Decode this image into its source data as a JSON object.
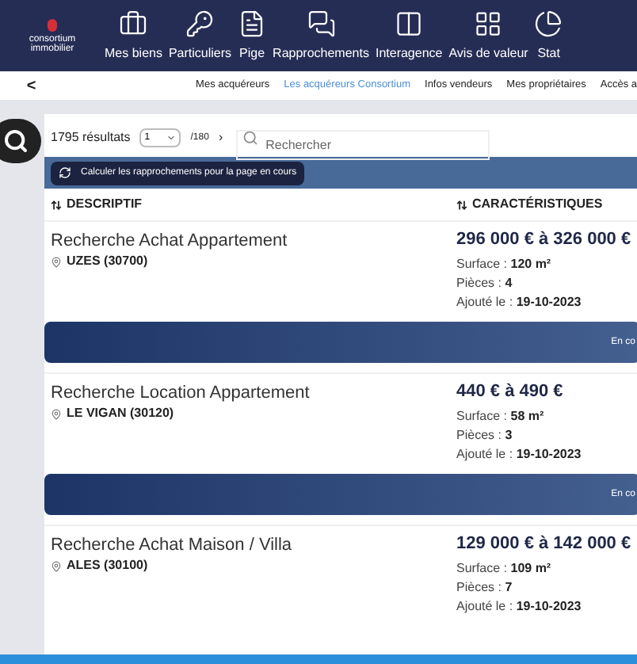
{
  "nav": {
    "items": [
      {
        "label": "Mes biens"
      },
      {
        "label": "Particuliers"
      },
      {
        "label": "Pige"
      },
      {
        "label": "Rapprochements"
      },
      {
        "label": "Interagence"
      },
      {
        "label": "Avis de valeur"
      },
      {
        "label": "Stat"
      }
    ]
  },
  "logo": {
    "line1": "consortium",
    "line2": "immobilier"
  },
  "subnav": {
    "back": "<",
    "tabs": [
      {
        "label": "Mes acquéreurs",
        "selected": false
      },
      {
        "label": "Les acquéreurs Consortium",
        "selected": true
      },
      {
        "label": "Infos vendeurs",
        "selected": false
      },
      {
        "label": "Mes propriétaires",
        "selected": false
      },
      {
        "label": "Accès a",
        "selected": false
      }
    ]
  },
  "toolbar": {
    "count": "1795 résultats",
    "page": "1",
    "total": "/180",
    "next": "›",
    "search_placeholder": "Rechercher"
  },
  "action_button": "Calculer les rapprochements pour la page en cours",
  "table": {
    "columns": [
      "DESCRIPTIF",
      "CARACTÉRISTIQUES"
    ],
    "rows": [
      {
        "title": "Recherche Achat Appartement",
        "location": "UZES (30700)",
        "price": "296 000 € à 326 000 €",
        "fields": [
          {
            "label": "Surface :",
            "value": "120 m²"
          },
          {
            "label": "Pièces :",
            "value": "4"
          },
          {
            "label": "Ajouté le :",
            "value": "19-10-2023"
          }
        ],
        "banner": "En co"
      },
      {
        "title": "Recherche Location Appartement",
        "location": "LE VIGAN (30120)",
        "price": "440 € à 490 €",
        "fields": [
          {
            "label": "Surface :",
            "value": "58 m²"
          },
          {
            "label": "Pièces :",
            "value": "3"
          },
          {
            "label": "Ajouté le :",
            "value": "19-10-2023"
          }
        ],
        "banner": "En co"
      },
      {
        "title": "Recherche Achat Maison / Villa",
        "location": "ALES (30100)",
        "price": "129 000 € à 142 000 €",
        "fields": [
          {
            "label": "Surface :",
            "value": "109 m²"
          },
          {
            "label": "Pièces :",
            "value": "7"
          },
          {
            "label": "Ajouté le :",
            "value": "19-10-2023"
          }
        ]
      }
    ]
  }
}
